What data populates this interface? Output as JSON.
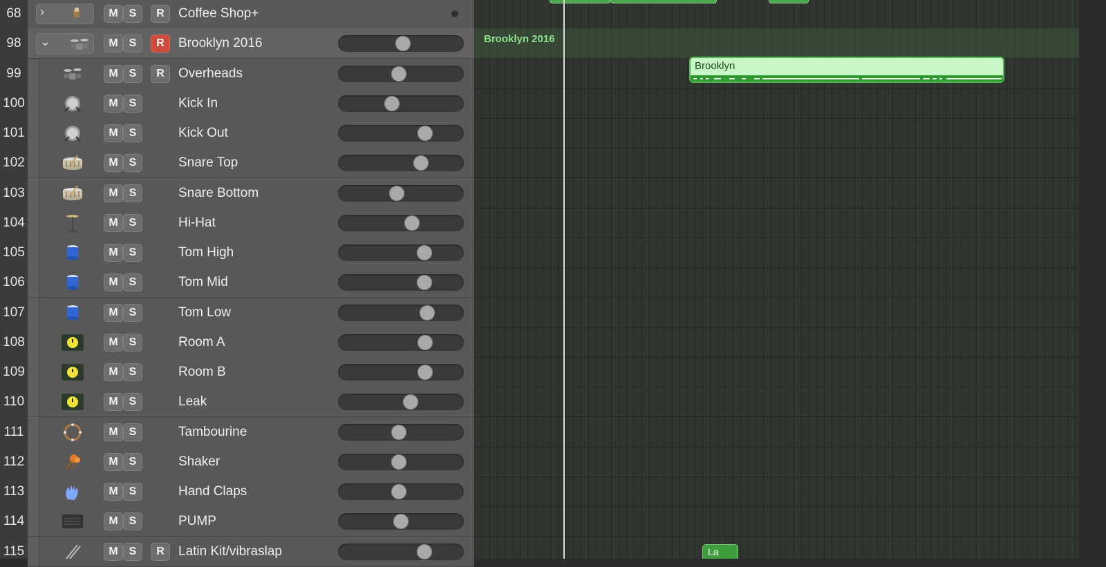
{
  "buttons": {
    "mute": "M",
    "solo": "S",
    "record": "R"
  },
  "tracks": [
    {
      "num": "68",
      "name": "Coffee Shop+",
      "icon": "folder-stack-icon",
      "type": "folder"
    },
    {
      "num": "98",
      "name": "Brooklyn 2016",
      "icon": "drum-kit-icon",
      "type": "summing-stack",
      "volume": 0.52
    },
    {
      "num": "99",
      "name": "Overheads",
      "icon": "drum-kit-icon",
      "volume": 0.48
    },
    {
      "num": "100",
      "name": "Kick In",
      "icon": "kick-drum-icon",
      "volume": 0.42
    },
    {
      "num": "101",
      "name": "Kick Out",
      "icon": "kick-drum-icon",
      "volume": 0.72
    },
    {
      "num": "102",
      "name": "Snare Top",
      "icon": "snare-drum-icon",
      "volume": 0.68
    },
    {
      "num": "103",
      "name": "Snare Bottom",
      "icon": "snare-drum-icon",
      "volume": 0.46
    },
    {
      "num": "104",
      "name": "Hi-Hat",
      "icon": "hi-hat-icon",
      "volume": 0.6
    },
    {
      "num": "105",
      "name": "Tom High",
      "icon": "tom-drum-icon",
      "volume": 0.71
    },
    {
      "num": "106",
      "name": "Tom Mid",
      "icon": "tom-drum-icon",
      "volume": 0.71
    },
    {
      "num": "107",
      "name": "Tom Low",
      "icon": "tom-drum-icon",
      "volume": 0.74
    },
    {
      "num": "108",
      "name": "Room A",
      "icon": "audio-clock-icon",
      "volume": 0.72
    },
    {
      "num": "109",
      "name": "Room B",
      "icon": "audio-clock-icon",
      "volume": 0.72
    },
    {
      "num": "110",
      "name": "Leak",
      "icon": "audio-clock-icon",
      "volume": 0.59
    },
    {
      "num": "111",
      "name": "Tambourine",
      "icon": "tambourine-icon",
      "volume": 0.48
    },
    {
      "num": "112",
      "name": "Shaker",
      "icon": "shaker-icon",
      "volume": 0.48
    },
    {
      "num": "113",
      "name": "Hand Claps",
      "icon": "hand-clap-icon",
      "volume": 0.48
    },
    {
      "num": "114",
      "name": "PUMP",
      "icon": "pump-module-icon",
      "volume": 0.5
    },
    {
      "num": "115",
      "name": "Latin Kit/vibraslap",
      "icon": "drumsticks-icon",
      "volume": 0.71
    }
  ],
  "arrange": {
    "stack_label": "Brooklyn 2016",
    "region_brooklyn": "Brooklyn",
    "region_la": "La"
  },
  "colors": {
    "region_green": "#4aa64a",
    "region_light": "#c7f7c7",
    "record_active": "#cc4a3d"
  }
}
